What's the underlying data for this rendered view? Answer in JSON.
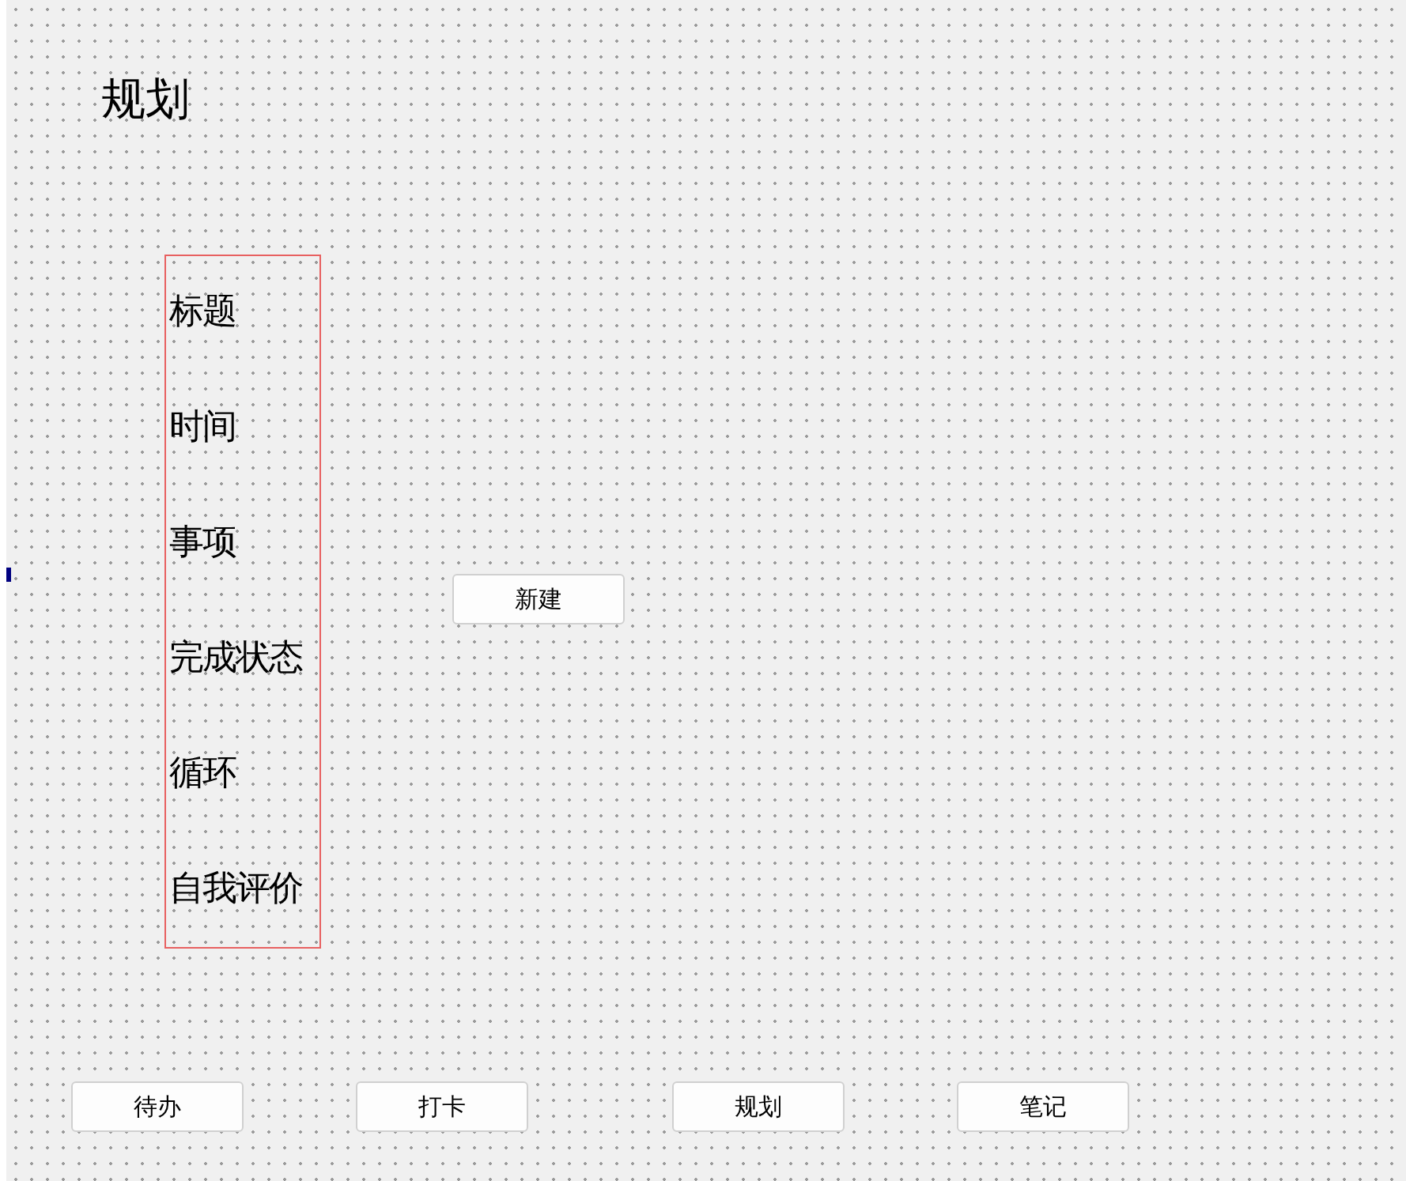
{
  "title": "规划",
  "labels": [
    "标题",
    "时间",
    "事项",
    "完成状态",
    "循环",
    "自我评价"
  ],
  "new_button": "新建",
  "nav_buttons": [
    "待办",
    "打卡",
    "规划",
    "笔记"
  ]
}
